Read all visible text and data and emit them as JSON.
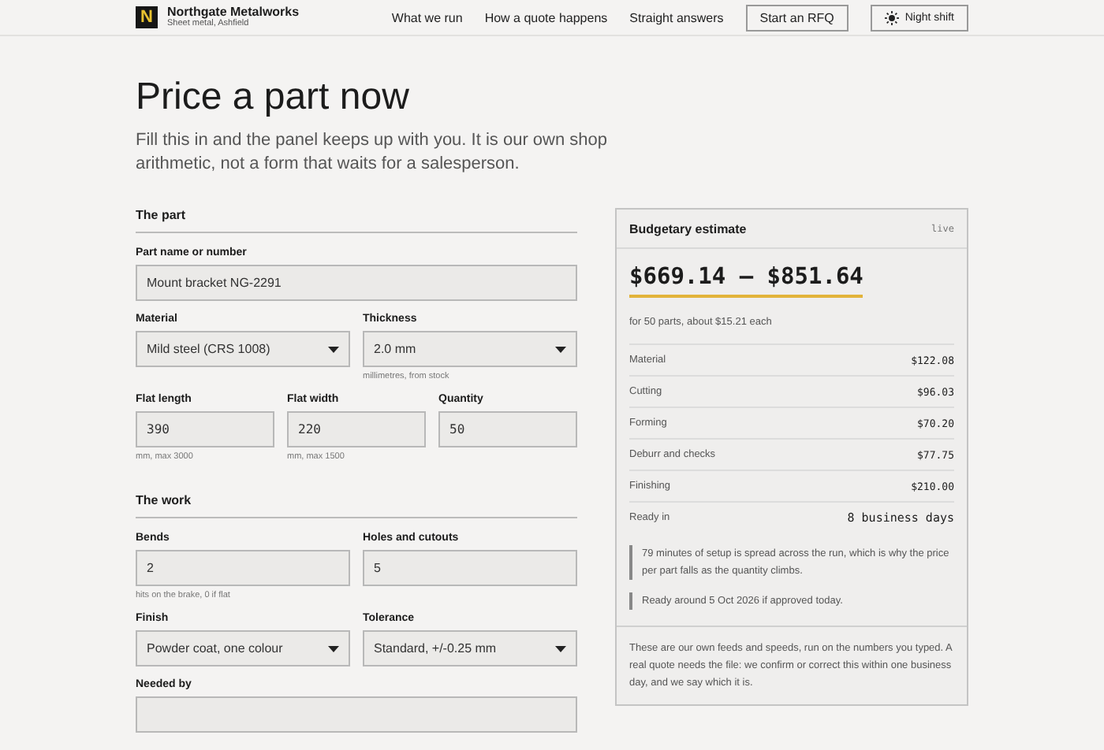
{
  "header": {
    "brand": {
      "name": "Northgate Metalworks",
      "tagline": "Sheet metal, Ashfield",
      "logo_letter": "N"
    },
    "nav": [
      "What we run",
      "How a quote happens",
      "Straight answers"
    ],
    "cta": "Start an RFQ",
    "theme_toggle": "Night shift"
  },
  "intro": {
    "title": "Price a part now",
    "lede": "Fill this in and the panel keeps up with you. It is our own shop arithmetic, not a form that waits for a salesperson."
  },
  "sections": [
    {
      "title": "The part",
      "rows": [
        [
          {
            "label": "Part name or number",
            "kind": "text",
            "value": "Mount bracket NG-2291"
          }
        ],
        [
          {
            "label": "Material",
            "kind": "select",
            "value": "Mild steel (CRS 1008)"
          },
          {
            "label": "Thickness",
            "kind": "select",
            "value": "2.0 mm",
            "hint": "millimetres, from stock"
          }
        ],
        [
          {
            "label": "Flat length",
            "kind": "mono",
            "value": "390",
            "hint": "mm, max 3000"
          },
          {
            "label": "Flat width",
            "kind": "mono",
            "value": "220",
            "hint": "mm, max 1500"
          },
          {
            "label": "Quantity",
            "kind": "mono",
            "value": "50"
          }
        ]
      ]
    },
    {
      "title": "The work",
      "rows": [
        [
          {
            "label": "Bends",
            "kind": "text",
            "value": "2",
            "hint": "hits on the brake, 0 if flat"
          },
          {
            "label": "Holes and cutouts",
            "kind": "text",
            "value": "5"
          }
        ],
        [
          {
            "label": "Finish",
            "kind": "select",
            "value": "Powder coat, one colour"
          },
          {
            "label": "Tolerance",
            "kind": "select",
            "value": "Standard, +/-0.25 mm"
          }
        ],
        [
          {
            "label": "Needed by",
            "kind": "text"
          }
        ]
      ]
    }
  ],
  "estimate": {
    "title": "Budgetary estimate",
    "badge": "live",
    "range": "$669.14 – $851.64",
    "per_unit": "for 50 parts, about $15.21 each",
    "lines": [
      {
        "label": "Material",
        "value": "$122.08"
      },
      {
        "label": "Cutting",
        "value": "$96.03"
      },
      {
        "label": "Forming",
        "value": "$70.20"
      },
      {
        "label": "Deburr and checks",
        "value": "$77.75"
      },
      {
        "label": "Finishing",
        "value": "$210.00"
      },
      {
        "label": "Ready in",
        "value": "8 business days"
      }
    ],
    "notes": [
      "79 minutes of setup is spread across the run, which is why the price per part falls as the quantity climbs.",
      "Ready around 5 Oct 2026 if approved today."
    ],
    "footer": "These are our own feeds and speeds, run on the numbers you typed. A real quote needs the file: we confirm or correct this within one business day, and we say which it is."
  }
}
